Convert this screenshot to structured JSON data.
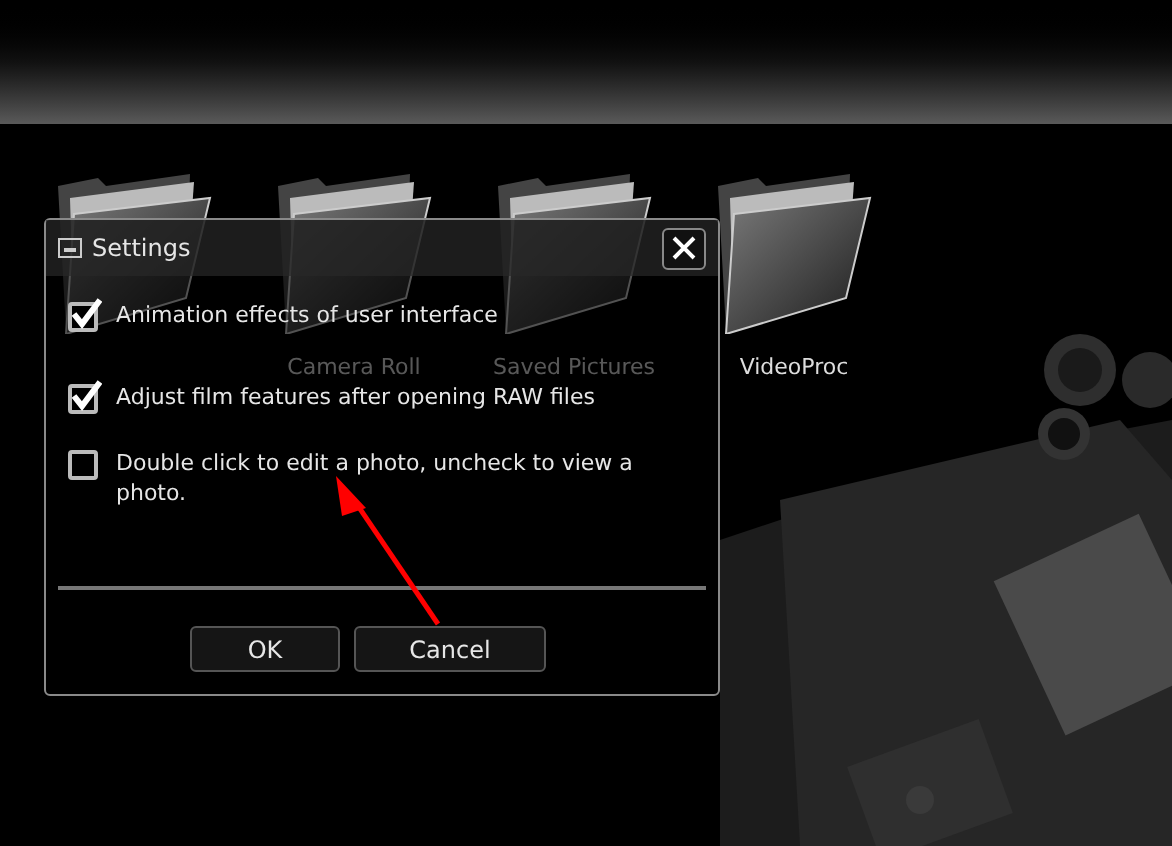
{
  "folders": [
    {
      "label": "Camera Roll"
    },
    {
      "label": "Saved Pictures"
    },
    {
      "label": "VideoProc"
    }
  ],
  "dialog": {
    "title": "Settings",
    "options": [
      {
        "label": "Animation effects of user interface",
        "checked": true
      },
      {
        "label": "Adjust film features after opening RAW files",
        "checked": true
      },
      {
        "label": "Double click to edit a photo, uncheck to view a photo.",
        "checked": false
      }
    ],
    "buttons": [
      "OK",
      "Cancel"
    ]
  }
}
